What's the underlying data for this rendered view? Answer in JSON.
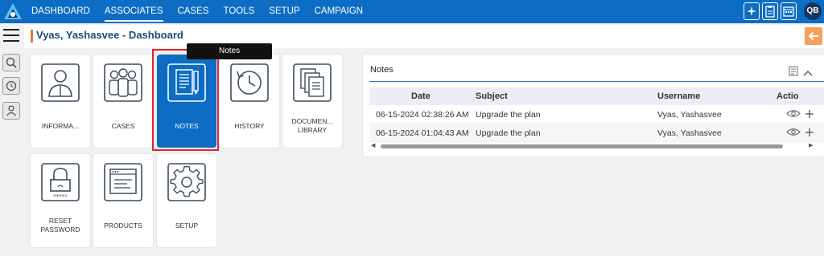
{
  "nav": {
    "items": [
      "DASHBOARD",
      "ASSOCIATES",
      "CASES",
      "TOOLS",
      "SETUP",
      "CAMPAIGN"
    ],
    "active": "ASSOCIATES"
  },
  "user": {
    "initials": "QB"
  },
  "header": {
    "title": "Vyas, Yashasvee - Dashboard"
  },
  "tooltip": {
    "text": "Notes"
  },
  "tiles": [
    {
      "label": "INFORMA...",
      "icon": "person-icon"
    },
    {
      "label": "CASES",
      "icon": "group-icon"
    },
    {
      "label": "NOTES",
      "icon": "notes-icon"
    },
    {
      "label": "HISTORY",
      "icon": "clock-icon"
    },
    {
      "label": "DOCUMEN... LIBRARY",
      "icon": "documents-icon"
    },
    {
      "label": "RESET PASSWORD",
      "icon": "lock-icon"
    },
    {
      "label": "PRODUCTS",
      "icon": "browser-window-icon"
    },
    {
      "label": "SETUP",
      "icon": "gear-icon"
    }
  ],
  "notes_panel": {
    "title": "Notes",
    "columns": [
      "Date",
      "Subject",
      "Username",
      "Actio"
    ],
    "rows": [
      {
        "date": "06-15-2024 02:38:26 AM",
        "subject": "Upgrade the plan",
        "username": "Vyas, Yashasvee"
      },
      {
        "date": "06-15-2024 01:04:43 AM",
        "subject": "Upgrade the plan",
        "username": "Vyas, Yashasvee"
      }
    ]
  },
  "colors": {
    "nav_bg": "#0d6cc4",
    "active_tile": "#0d6cc4",
    "highlight": "#e0242e",
    "accent": "#e8753a",
    "title": "#1b4a7a"
  }
}
